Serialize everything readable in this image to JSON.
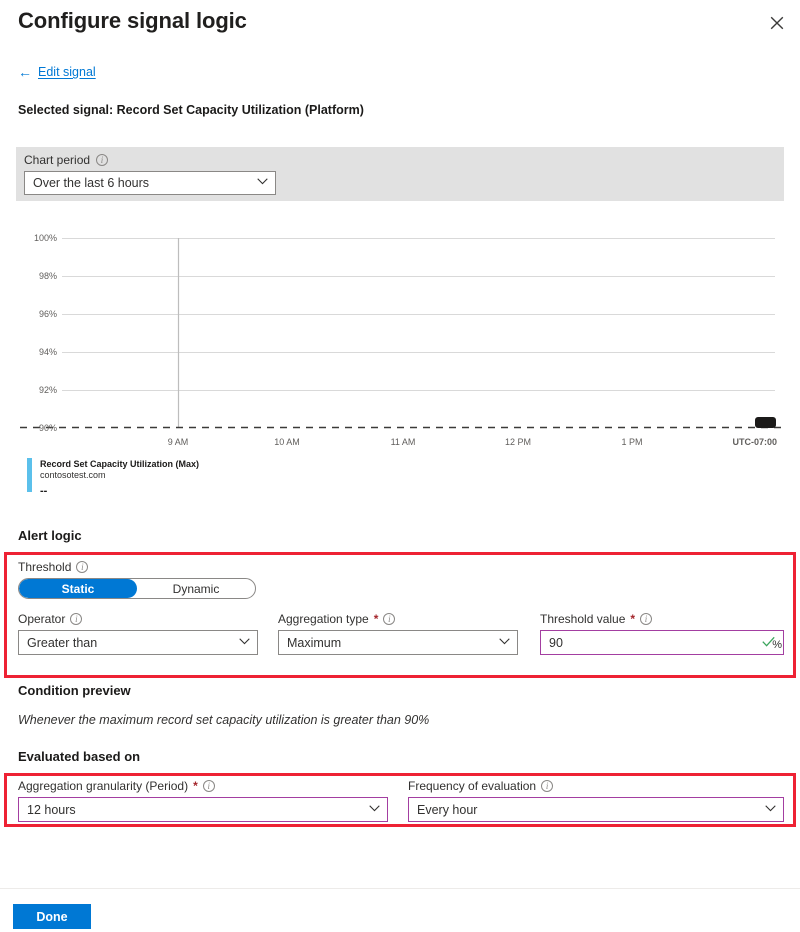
{
  "header": {
    "title": "Configure signal logic",
    "close_icon": "close-icon",
    "back_link": {
      "arrow": "←",
      "label": "Edit signal"
    },
    "selected_signal": "Selected signal: Record Set Capacity Utilization (Platform)"
  },
  "chart_period": {
    "label": "Chart period",
    "info_icon": "info-icon",
    "value": "Over the last 6 hours",
    "caret_icon": "chevron-down-icon"
  },
  "legend": {
    "color": "#5bc0eb",
    "title": "Record Set Capacity Utilization (Max)",
    "subtitle": "contosotest.com",
    "value": "--"
  },
  "alert_logic": {
    "heading": "Alert logic",
    "threshold": {
      "label": "Threshold",
      "info_icon": "info-icon",
      "options": [
        "Static",
        "Dynamic"
      ],
      "selected": "Static"
    },
    "operator": {
      "label": "Operator",
      "info_icon": "info-icon",
      "value": "Greater than",
      "caret_icon": "chevron-down-icon"
    },
    "aggregation_type": {
      "label": "Aggregation type",
      "required": "*",
      "info_icon": "info-icon",
      "value": "Maximum",
      "caret_icon": "chevron-down-icon"
    },
    "threshold_value": {
      "label": "Threshold value",
      "required": "*",
      "info_icon": "info-icon",
      "value": "90",
      "unit": "%",
      "valid_icon": "checkmark-icon"
    }
  },
  "condition_preview": {
    "heading": "Condition preview",
    "text": "Whenever the maximum record set capacity utilization is greater than 90%"
  },
  "evaluated_based_on": {
    "heading": "Evaluated based on",
    "granularity": {
      "label": "Aggregation granularity (Period)",
      "required": "*",
      "info_icon": "info-icon",
      "value": "12 hours",
      "caret_icon": "chevron-down-icon"
    },
    "frequency": {
      "label": "Frequency of evaluation",
      "info_icon": "info-icon",
      "value": "Every hour",
      "caret_icon": "chevron-down-icon"
    }
  },
  "footer": {
    "done_label": "Done"
  },
  "annotations": {
    "color": "#ee2234",
    "boxes": [
      "alert-logic",
      "evaluated-based-on"
    ]
  },
  "chart_data": {
    "type": "line",
    "title": "",
    "xlabel": "",
    "ylabel": "",
    "ylim": [
      90,
      100
    ],
    "y_ticks": [
      "90%",
      "92%",
      "94%",
      "96%",
      "98%",
      "100%"
    ],
    "y_tick_values": [
      90,
      92,
      94,
      96,
      98,
      100
    ],
    "x_ticks": [
      "9 AM",
      "10 AM",
      "11 AM",
      "12 PM",
      "1 PM"
    ],
    "timezone_label": "UTC-07:00",
    "grid": true,
    "series": [
      {
        "name": "Record Set Capacity Utilization (Max)",
        "resource": "contosotest.com",
        "color": "#5bc0eb",
        "values": []
      }
    ],
    "threshold_line": {
      "value": 90,
      "style": "dashed",
      "color": "#3b3a39"
    },
    "marker": {
      "x_fraction": 0.965,
      "value": 90,
      "color": "#1b1a19"
    }
  }
}
